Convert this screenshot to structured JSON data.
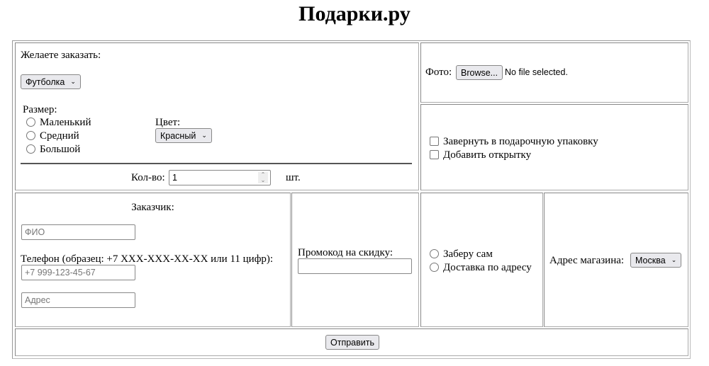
{
  "title": "Подарки.ру",
  "order": {
    "question": "Желаете заказать:",
    "product_select": "Футболка",
    "size_label": "Размер:",
    "sizes": [
      "Маленький",
      "Средний",
      "Большой"
    ],
    "color_label": "Цвет:",
    "color_select": "Красный",
    "qty_label": "Кол-во:",
    "qty_value": "1",
    "qty_unit": "шт."
  },
  "photo": {
    "label": "Фото:",
    "browse": "Browse...",
    "status": "No file selected."
  },
  "extras": [
    "Завернуть в подарочную упаковку",
    "Добавить открытку"
  ],
  "customer": {
    "heading": "Заказчик:",
    "name_placeholder": "ФИО",
    "phone_label": "Телефон (образец: +7 XXX-XXX-XX-XX или 11 цифр):",
    "phone_placeholder": "+7 999-123-45-67",
    "address_placeholder": "Адрес"
  },
  "promo": {
    "label": "Промокод на скидку:",
    "value": ""
  },
  "delivery": [
    "Заберу сам",
    "Доставка по адресу"
  ],
  "store": {
    "label": "Адрес магазина:",
    "select": "Москва"
  },
  "submit": "Отправить"
}
